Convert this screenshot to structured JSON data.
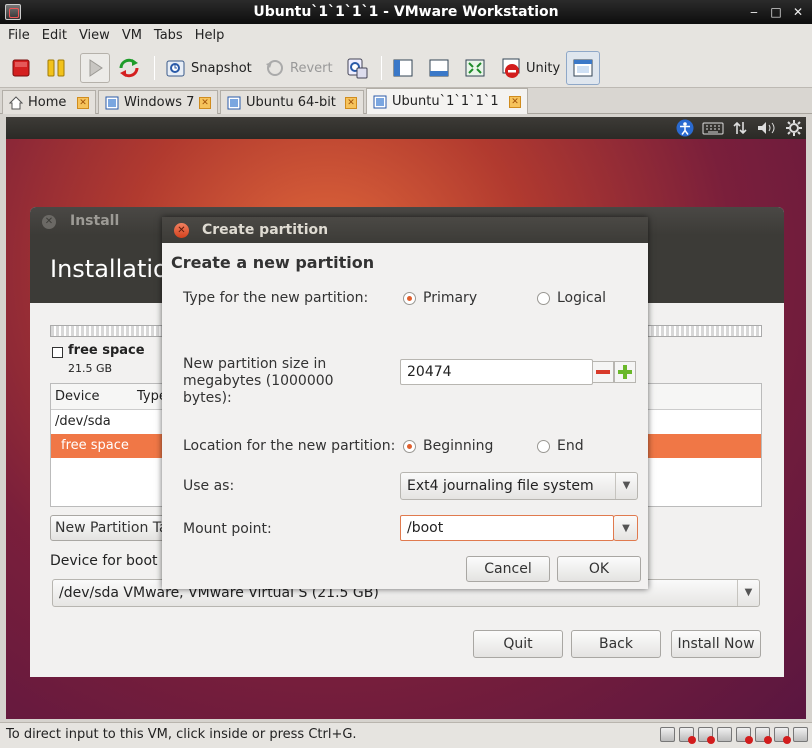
{
  "window": {
    "title": "Ubuntu`1`1`1`1 - VMware Workstation",
    "min": "‒",
    "max": "□",
    "close": "✕"
  },
  "menubar": {
    "items": [
      "File",
      "Edit",
      "View",
      "VM",
      "Tabs",
      "Help"
    ]
  },
  "toolbar": {
    "snapshot": "Snapshot",
    "revert": "Revert",
    "unity": "Unity"
  },
  "tabs": [
    {
      "label": "Home"
    },
    {
      "label": "Windows 7"
    },
    {
      "label": "Ubuntu 64-bit"
    },
    {
      "label": "Ubuntu`1`1`1`1"
    }
  ],
  "installer": {
    "window_title": "Install",
    "heading": "Installation type",
    "free_space_label": "free space",
    "free_space_size": "21.5 GB",
    "columns": [
      "Device",
      "Type"
    ],
    "rows": [
      "/dev/sda",
      "free space"
    ],
    "new_partition_table_label": "New Partition Table...",
    "boot_device_label": "Device for boot loader installation:",
    "boot_device_value": "/dev/sda  VMware, VMware Virtual S (21.5 GB)",
    "buttons": {
      "quit": "Quit",
      "back": "Back",
      "install_now": "Install Now"
    }
  },
  "dialog": {
    "title": "Create partition",
    "heading": "Create a new partition",
    "type_label": "Type for the new partition:",
    "type_primary": "Primary",
    "type_logical": "Logical",
    "size_label": "New partition size in megabytes (1000000 bytes):",
    "size_value": "20474",
    "location_label": "Location for the new partition:",
    "location_beginning": "Beginning",
    "location_end": "End",
    "use_as_label": "Use as:",
    "use_as_value": "Ext4 journaling file system",
    "mount_label": "Mount point:",
    "mount_value": "/boot",
    "cancel": "Cancel",
    "ok": "OK"
  },
  "statusbar": {
    "text": "To direct input to this VM, click inside or press Ctrl+G."
  },
  "colors": {
    "accent": "#f07746",
    "title_bar": "#3c3b37",
    "dialog_bg": "#f2f1f0"
  }
}
